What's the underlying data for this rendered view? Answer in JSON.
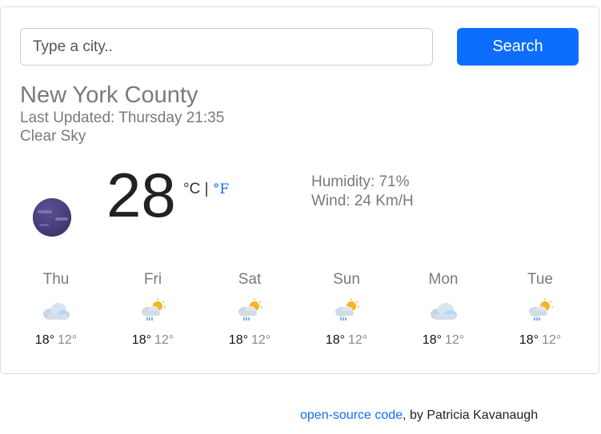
{
  "search": {
    "placeholder": "Type a city..",
    "button_label": "Search"
  },
  "weather": {
    "city": "New York County",
    "last_updated": "Last Updated: Thursday 21:35",
    "description": "Clear Sky",
    "icon": "night-clear-moon-icon",
    "temperature": "28",
    "unit_celsius": "°C",
    "unit_separator": " | ",
    "unit_fahrenheit": "°F",
    "humidity": "Humidity: 71%",
    "wind": "Wind: 24 Km/H"
  },
  "forecast": [
    {
      "day": "Thu",
      "icon": "cloud-icon",
      "high": "18°",
      "low": "12°"
    },
    {
      "day": "Fri",
      "icon": "sun-cloud-rain-icon",
      "high": "18°",
      "low": "12°"
    },
    {
      "day": "Sat",
      "icon": "sun-cloud-rain-icon",
      "high": "18°",
      "low": "12°"
    },
    {
      "day": "Sun",
      "icon": "sun-cloud-rain-icon",
      "high": "18°",
      "low": "12°"
    },
    {
      "day": "Mon",
      "icon": "cloud-icon",
      "high": "18°",
      "low": "12°"
    },
    {
      "day": "Tue",
      "icon": "sun-cloud-rain-icon",
      "high": "18°",
      "low": "12°"
    }
  ],
  "footer": {
    "link_text": "open-source code",
    "suffix": ", by Patricia Kavanaugh"
  },
  "colors": {
    "accent": "#0d6efd",
    "moon": "#4b3f7f"
  }
}
